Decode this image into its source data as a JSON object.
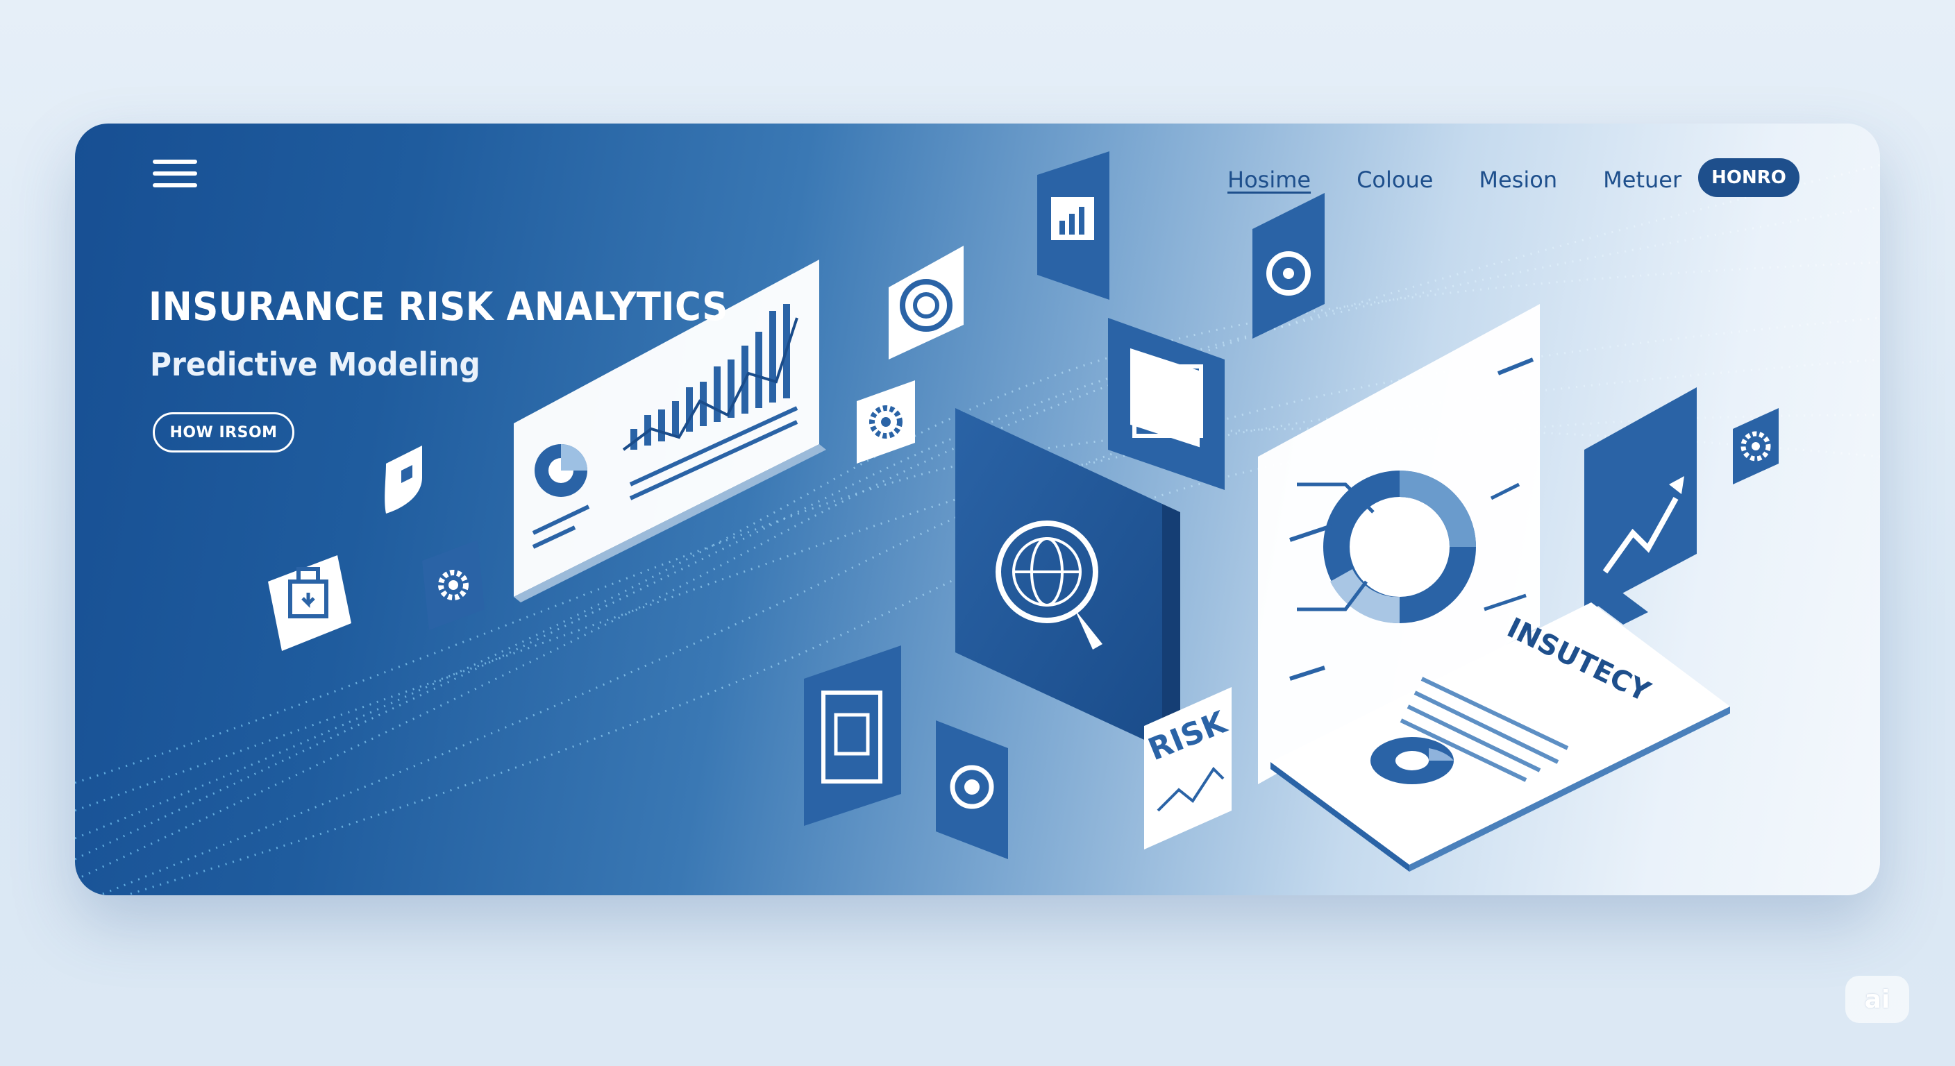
{
  "header": {
    "menu_icon": "hamburger-menu-icon",
    "nav": [
      {
        "label": "Hosime",
        "active": true
      },
      {
        "label": "Coloue",
        "active": false
      },
      {
        "label": "Mesion",
        "active": false
      },
      {
        "label": "Metuer",
        "active": false
      }
    ],
    "cta_label": "HONRO"
  },
  "hero": {
    "title": "INSURANCE RISK ANALYTICS",
    "subtitle": "Predictive Modeling",
    "cta_label": "HOW IRSOM"
  },
  "cards": {
    "risk_label": "RISK",
    "clipboard_label": "INSUTECY"
  },
  "icons": [
    "shield-icon",
    "gear-icon",
    "target-icon",
    "chart-icon",
    "globe-search-icon",
    "growth-arrow-icon",
    "clipboard-icon",
    "lock-icon",
    "chip-icon"
  ],
  "badge": {
    "label": "ai"
  },
  "colors": {
    "brand_dark": "#1e4f8c",
    "brand_mid": "#3a78b4",
    "light_card": "#ffffff",
    "background": "#e1ecf7"
  }
}
